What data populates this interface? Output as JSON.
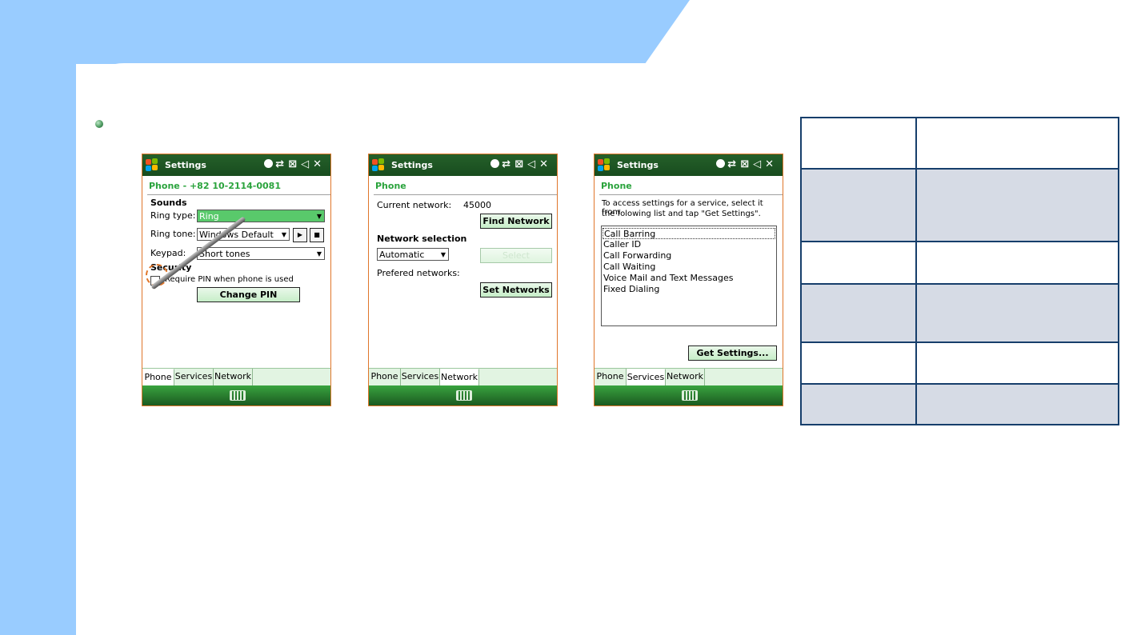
{
  "colors": {
    "background": "#99ccff",
    "phone_border": "#e0762a",
    "titlebar": "#1d5a22",
    "header_green": "#2aa33c",
    "table_border": "#163e6b",
    "table_shade": "#d6dbe5"
  },
  "screens": [
    {
      "title": "Settings",
      "header": "Phone - +82 10-2114-0081",
      "sounds_label": "Sounds",
      "ring_type_label": "Ring type:",
      "ring_type_value": "Ring",
      "ring_tone_label": "Ring tone:",
      "ring_tone_value": "Windows Default",
      "keypad_label": "Keypad:",
      "keypad_value": "Short tones",
      "security_label": "Security",
      "require_pin_label": "Require PIN when phone is used",
      "require_pin_checked": false,
      "change_pin_label": "Change PIN",
      "tabs": [
        "Phone",
        "Services",
        "Network"
      ],
      "active_tab": "Phone"
    },
    {
      "title": "Settings",
      "header": "Phone",
      "current_network_label": "Current network:",
      "current_network_value": "45000",
      "find_network_label": "Find Network",
      "network_selection_label": "Network selection",
      "network_selection_value": "Automatic",
      "select_label": "Select",
      "preferred_networks_label": "Prefered networks:",
      "set_networks_label": "Set Networks",
      "tabs": [
        "Phone",
        "Services",
        "Network"
      ],
      "active_tab": "Network"
    },
    {
      "title": "Settings",
      "header": "Phone",
      "instructions_line1": "To access settings for a service, select it from",
      "instructions_line2": "the folowing list and tap \"Get Settings\".",
      "services": [
        "Call Barring",
        "Caller ID",
        "Call Forwarding",
        "Call Waiting",
        "Voice Mail and Text Messages",
        "Fixed Dialing"
      ],
      "focused_service": "Call Barring",
      "get_settings_label": "Get Settings...",
      "tabs": [
        "Phone",
        "Services",
        "Network"
      ],
      "active_tab": "Services"
    }
  ],
  "statusbar_icons": [
    "connectivity-icon",
    "data-transfer-icon",
    "no-signal-icon",
    "speaker-muted-icon",
    "close-icon"
  ],
  "info_table": {
    "rows": 6,
    "shaded_rows": [
      1,
      3,
      5
    ]
  }
}
